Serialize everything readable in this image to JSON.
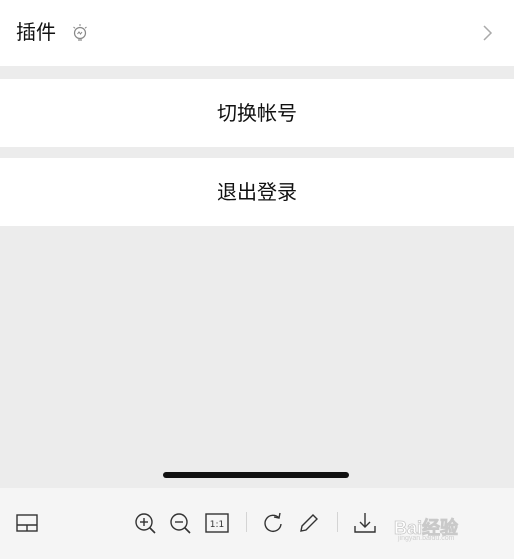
{
  "settings": {
    "plugins_label": "插件",
    "switch_account_label": "切换帐号",
    "logout_label": "退出登录"
  },
  "toolbar": {
    "fit_label": "1:1",
    "icons": [
      "layout-icon",
      "zoom-in-icon",
      "zoom-out-icon",
      "actual-size-icon",
      "rotate-icon",
      "edit-icon",
      "download-icon"
    ]
  },
  "watermark": {
    "text": "Bai经验",
    "url": "jingyan.baidu.com"
  }
}
